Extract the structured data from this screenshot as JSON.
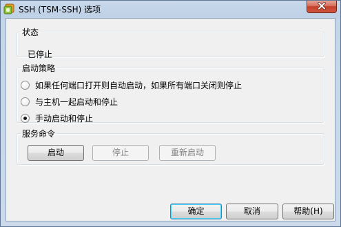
{
  "window": {
    "title": "SSH (TSM-SSH) 选项"
  },
  "status_group": {
    "legend": "状态",
    "value": "已停止"
  },
  "policy_group": {
    "legend": "启动策略",
    "options": [
      {
        "label": "如果任何端口打开则自动启动，如果所有端口关闭则停止",
        "selected": false
      },
      {
        "label": "与主机一起启动和停止",
        "selected": false
      },
      {
        "label": "手动启动和停止",
        "selected": true
      }
    ]
  },
  "service_group": {
    "legend": "服务命令",
    "start_label": "启动",
    "stop_label": "停止",
    "restart_label": "重新启动"
  },
  "footer": {
    "ok_label": "确定",
    "cancel_label": "取消",
    "help_label": "帮助(H)"
  },
  "icons": {
    "app": "vsphere-logo-icon",
    "close": "close-icon"
  },
  "colors": {
    "close_button": "#c3412a",
    "default_button_border": "#3c7fb1"
  }
}
